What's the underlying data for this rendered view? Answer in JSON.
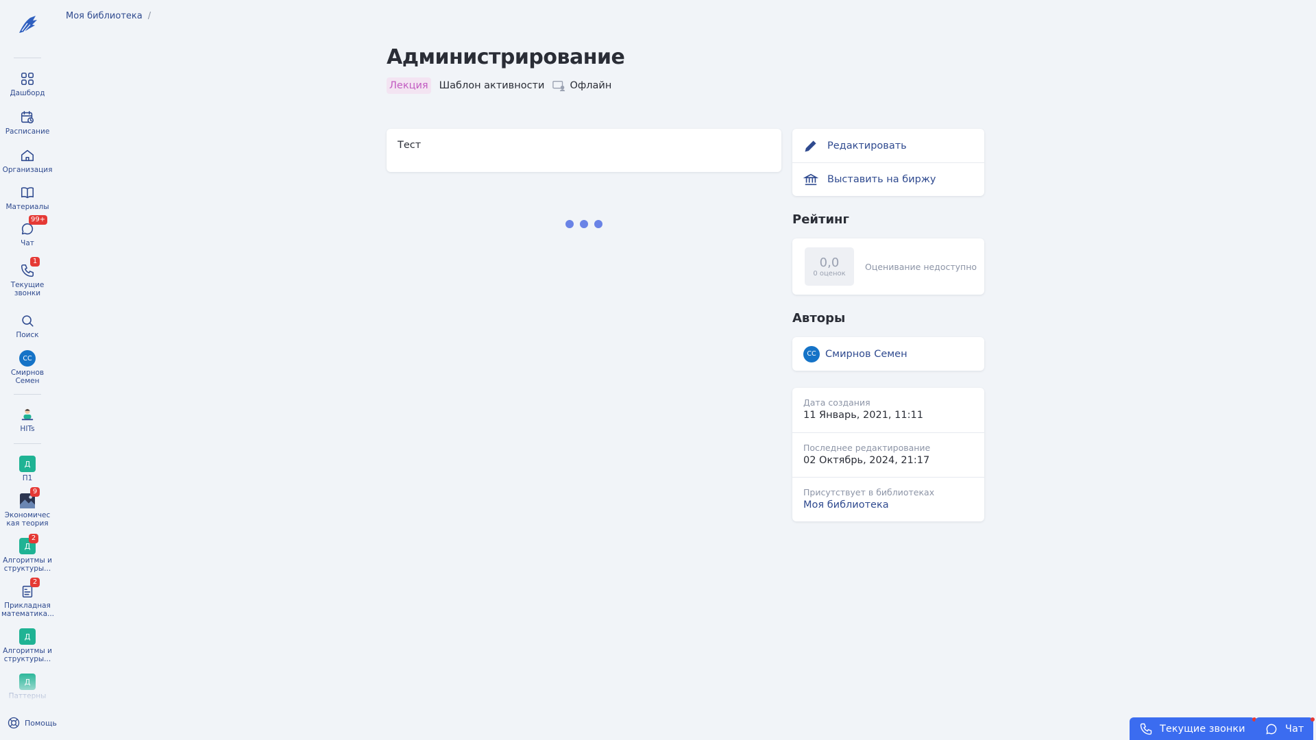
{
  "colors": {
    "accent": "#3b6cf0",
    "nav": "#2f4a8f",
    "badge": "#e53935",
    "type_tag": "#c25bc2",
    "loader": "#6a83e6"
  },
  "breadcrumb": {
    "items": [
      "Моя библиотека"
    ],
    "separator": "/"
  },
  "page": {
    "title": "Администрирование",
    "type_tag": "Лекция",
    "template": "Шаблон активности",
    "mode": "Офлайн"
  },
  "content": {
    "text": "Тест"
  },
  "sidebar": {
    "items": [
      {
        "label": "Дашборд",
        "icon": "dashboard-icon"
      },
      {
        "label": "Расписание",
        "icon": "schedule-icon"
      },
      {
        "label": "Организация",
        "icon": "organization-icon"
      },
      {
        "label": "Материалы",
        "icon": "book-icon"
      },
      {
        "label": "Чат",
        "icon": "chat-icon",
        "badge": "99+"
      },
      {
        "label": "Текущие звонки",
        "icon": "phone-icon",
        "badge": "1"
      },
      {
        "label": "Поиск",
        "icon": "search-icon"
      },
      {
        "label": "Смирнов Семен",
        "avatar": "СС"
      },
      {
        "label": "HITs",
        "icon": "hits-mascot-icon"
      },
      {
        "label": "П1",
        "letter": "Д"
      },
      {
        "label": "Экономическая теория",
        "icon": "course-image-icon",
        "badge": "9"
      },
      {
        "label": "Алгоритмы и структуры...",
        "letter": "Д",
        "badge": "2"
      },
      {
        "label": "Прикладная математика...",
        "icon": "course-doc-icon",
        "badge": "2"
      },
      {
        "label": "Алгоритмы и структуры...",
        "letter": "Д"
      },
      {
        "label": "Паттерны",
        "letter": "Д"
      }
    ],
    "help": "Помощь"
  },
  "actions": {
    "edit": "Редактировать",
    "exchange": "Выставить на биржу"
  },
  "rating": {
    "heading": "Рейтинг",
    "value": "0,0",
    "count": "0 оценок",
    "note": "Оценивание недоступно"
  },
  "authors": {
    "heading": "Авторы",
    "list": [
      {
        "initials": "СС",
        "name": "Смирнов Семен"
      }
    ]
  },
  "meta": {
    "created_label": "Дата создания",
    "created": "11 Январь, 2021, 11:11",
    "edited_label": "Последнее редактирование",
    "edited": "02 Октябрь, 2024, 21:17",
    "libraries_label": "Присутствует в библиотеках",
    "libraries": "Моя библиотека"
  },
  "bottom": {
    "calls": "Текущие звонки",
    "chat": "Чат"
  }
}
